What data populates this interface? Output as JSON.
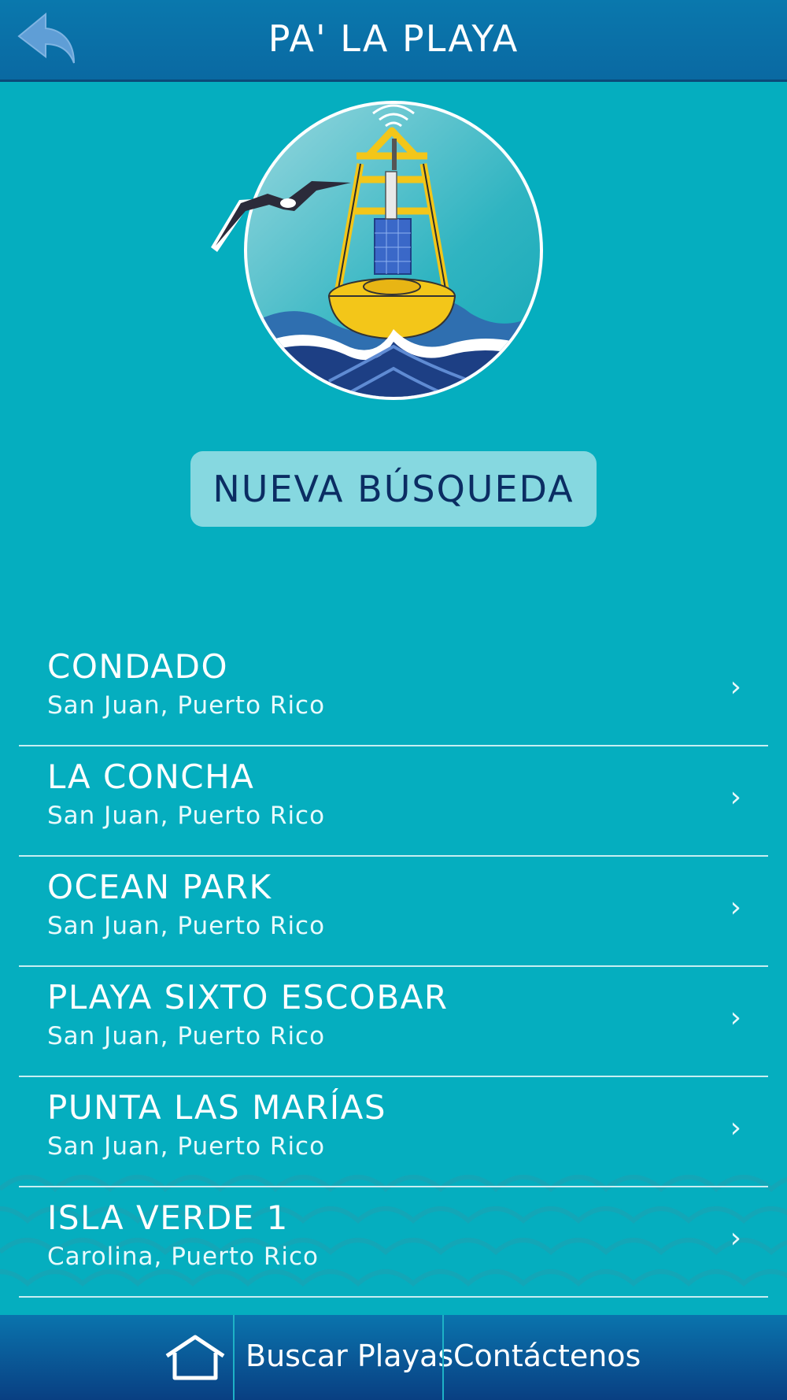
{
  "header": {
    "title": "PA' LA PLAYA",
    "back_icon": "back-arrow-icon"
  },
  "logo": {
    "icon": "buoy-logo"
  },
  "search": {
    "new_search_label": "NUEVA BÚSQUEDA"
  },
  "beaches": [
    {
      "name": "CONDADO",
      "location": "San Juan, Puerto Rico"
    },
    {
      "name": "LA CONCHA",
      "location": "San Juan, Puerto Rico"
    },
    {
      "name": "OCEAN PARK",
      "location": "San Juan, Puerto Rico"
    },
    {
      "name": "PLAYA SIXTO ESCOBAR",
      "location": "San Juan, Puerto Rico"
    },
    {
      "name": "PUNTA LAS MARÍAS",
      "location": "San Juan, Puerto Rico"
    },
    {
      "name": "ISLA VERDE 1",
      "location": "Carolina, Puerto Rico"
    }
  ],
  "chevron": "›",
  "tabbar": {
    "home_icon": "home-icon",
    "tab1": "Buscar Playas",
    "tab2": "Contáctenos"
  },
  "colors": {
    "background": "#05aebf",
    "header": "#0a78ad",
    "button": "#86d8e0",
    "button_text": "#0b2d63"
  }
}
